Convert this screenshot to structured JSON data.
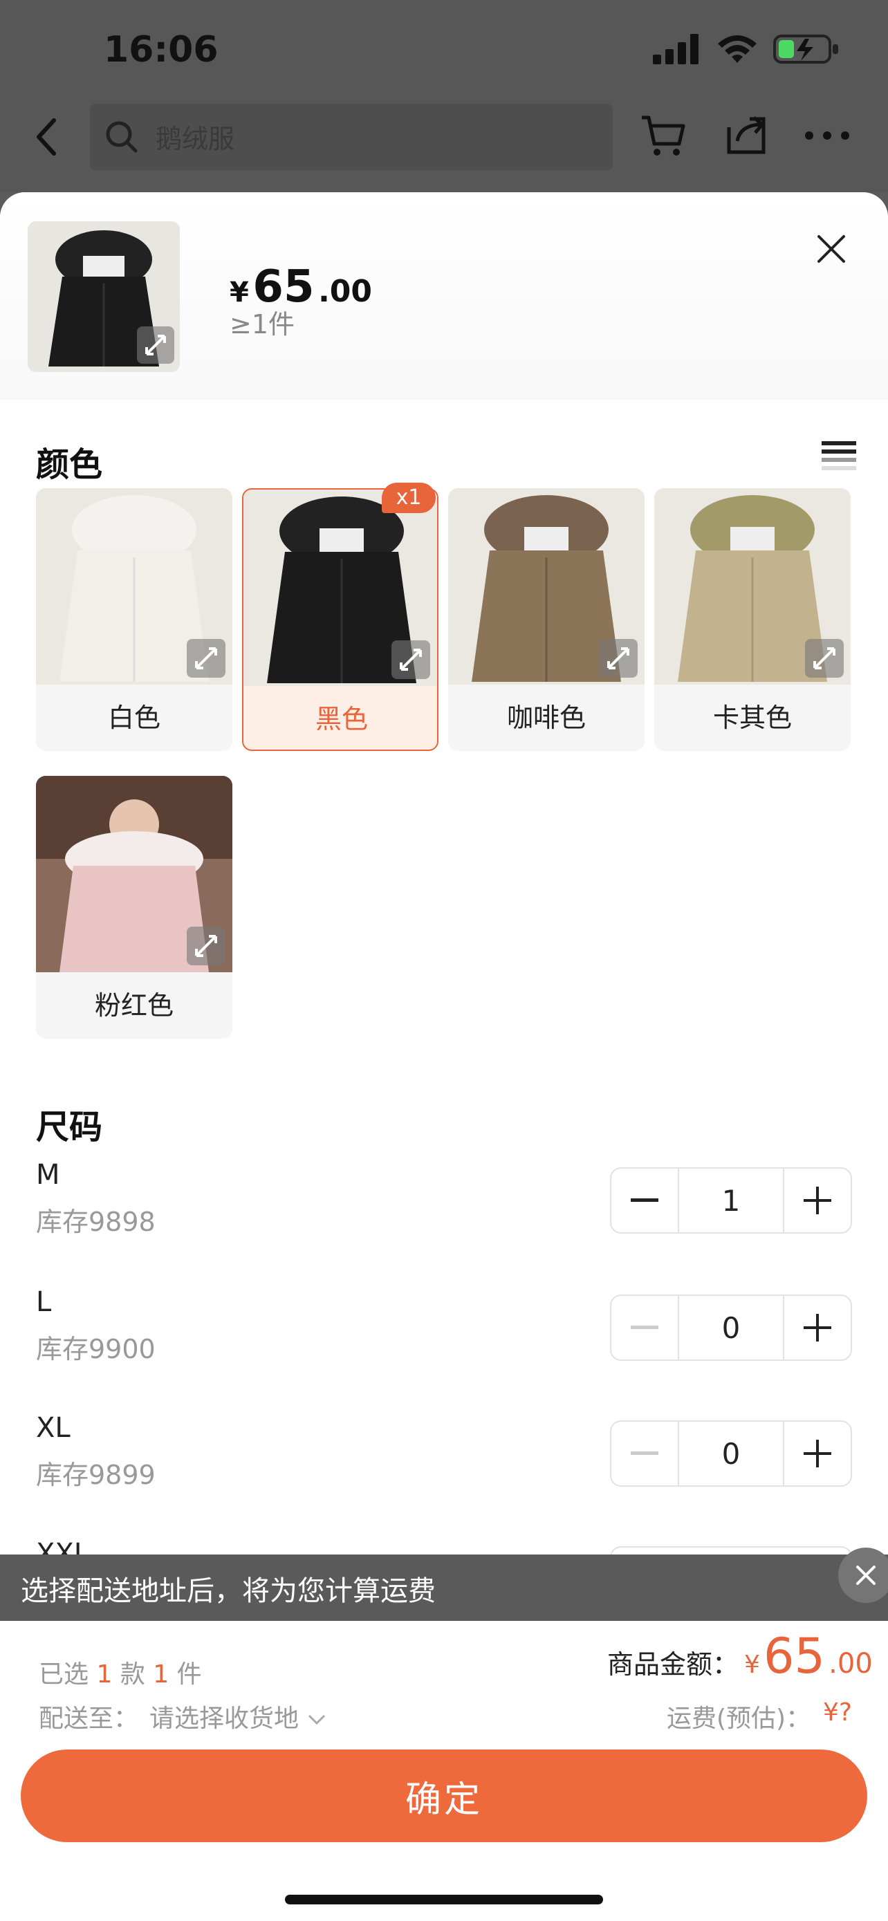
{
  "status_bar": {
    "time": "16:06"
  },
  "nav": {
    "search_placeholder": "鹅绒服"
  },
  "product": {
    "price_currency": "¥",
    "price_integer": "65",
    "price_decimal": ".00",
    "min_qty": "≥1件"
  },
  "colors": {
    "title": "颜色",
    "items": [
      {
        "label": "白色",
        "selected": false
      },
      {
        "label": "黑色",
        "selected": true,
        "badge": "x1"
      },
      {
        "label": "咖啡色",
        "selected": false
      },
      {
        "label": "卡其色",
        "selected": false
      },
      {
        "label": "粉红色",
        "selected": false
      }
    ]
  },
  "sizes": {
    "title": "尺码",
    "items": [
      {
        "name": "M",
        "stock": "库存9898",
        "qty": "1"
      },
      {
        "name": "L",
        "stock": "库存9900",
        "qty": "0"
      },
      {
        "name": "XL",
        "stock": "库存9899",
        "qty": "0"
      },
      {
        "name": "XXL",
        "stock": "",
        "qty": ""
      }
    ]
  },
  "toast": {
    "text": "选择配送地址后，将为您计算运费"
  },
  "summary": {
    "selected_prefix": "已选",
    "selected_styles": "1",
    "styles_unit": "款",
    "selected_items": "1",
    "items_unit": "件",
    "ship_label": "配送至：",
    "ship_value": "请选择收货地",
    "amount_label": "商品金额：",
    "amount_currency": "¥",
    "amount_integer": "65",
    "amount_decimal": ".00",
    "freight_label": "运费(预估)：",
    "freight_value": "¥?"
  },
  "confirm_label": "确定",
  "colors_palette": {
    "accent": "#ee6a3c",
    "accent_text": "#e8643a"
  }
}
